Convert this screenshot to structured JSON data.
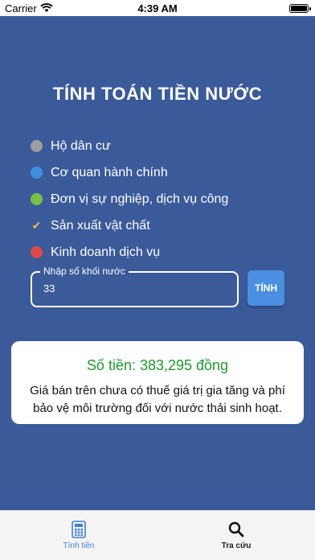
{
  "status_bar": {
    "carrier": "Carrier",
    "time": "4:39 AM"
  },
  "title": "TÍNH TOÁN TIỀN NƯỚC",
  "options": [
    {
      "label": "Hộ dân cư",
      "color": "#9e9e9e",
      "selected": false
    },
    {
      "label": "Cơ quan hành chính",
      "color": "#3d8fe0",
      "selected": false
    },
    {
      "label": "Đơn vị sự nghiệp, dịch vụ công",
      "color": "#7bc043",
      "selected": false
    },
    {
      "label": "Sản xuất vật chất",
      "color": "#f2b84b",
      "selected": true
    },
    {
      "label": "Kinh doanh dịch vụ",
      "color": "#e04848",
      "selected": false
    }
  ],
  "input": {
    "label": "Nhập số khối nước",
    "value": "33"
  },
  "calc_button": "TÍNH",
  "result": {
    "amount": "Số tiền: 383,295 đồng",
    "note": "Giá bán trên chưa có thuế giá trị gia tăng và phí bảo vệ môi trường đối với nước thải sinh hoạt."
  },
  "tabs": [
    {
      "label": "Tính tiền",
      "icon": "calculator-icon",
      "active": true
    },
    {
      "label": "Tra cứu",
      "icon": "search-icon",
      "active": false
    }
  ]
}
